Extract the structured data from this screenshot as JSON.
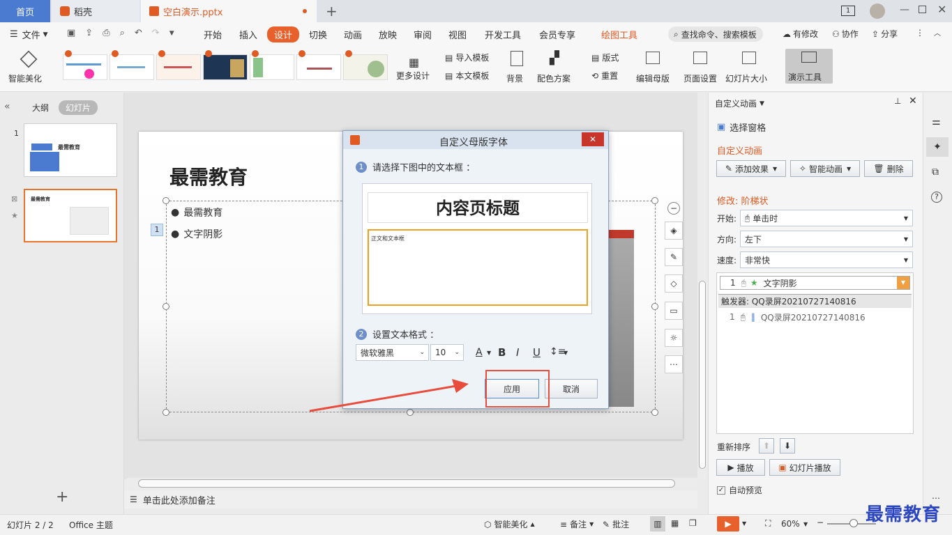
{
  "tabs": {
    "home": "首页",
    "daoke": "稻壳",
    "doc": "空白演示.pptx"
  },
  "menu": {
    "file": "文件",
    "items": [
      "开始",
      "插入",
      "设计",
      "切换",
      "动画",
      "放映",
      "审阅",
      "视图",
      "开发工具",
      "会员专享"
    ],
    "drawing_tools": "绘图工具",
    "search": "查找命令、搜索模板",
    "modify": "有修改",
    "collab": "协作",
    "share": "分享"
  },
  "ribbon": {
    "smart_beautify": "智能美化",
    "more_design": "更多设计",
    "import_template": "导入模板",
    "this_template": "本文模板",
    "background": "背景",
    "color_scheme": "配色方案",
    "layout": "版式",
    "reset": "重置",
    "edit_master": "编辑母版",
    "page_setup": "页面设置",
    "slide_size": "幻灯片大小",
    "present_tools": "演示工具",
    "theme_thumbs": [
      "",
      "",
      "",
      "",
      "",
      "",
      "",
      ""
    ]
  },
  "left": {
    "outline": "大纲",
    "slides": "幻灯片",
    "slide1_num": "1",
    "slide1_title": "最需教育",
    "slide2_num": "2",
    "slide2_title": "最需教育"
  },
  "slide": {
    "title": "最需教育",
    "bullet1": "最需教育",
    "bullet2": "文字阴影",
    "anim_tag": "1"
  },
  "notes": "单击此处添加备注",
  "dialog": {
    "title": "自定义母版字体",
    "step1": "请选择下图中的文本框 ：",
    "step1_num": "1",
    "preview_title": "内容页标题",
    "preview_body": "正文和文本框",
    "step2": "设置文本格式 ：",
    "step2_num": "2",
    "font": "微软雅黑",
    "size": "10",
    "apply": "应用",
    "cancel": "取消"
  },
  "anim": {
    "header": "自定义动画",
    "select_pane": "选择窗格",
    "section": "自定义动画",
    "add_effect": "添加效果",
    "smart_anim": "智能动画",
    "delete": "删除",
    "modify": "修改: 阶梯状",
    "start_label": "开始:",
    "start_val": "单击时",
    "dir_label": "方向:",
    "dir_val": "左下",
    "speed_label": "速度:",
    "speed_val": "非常快",
    "item1_num": "1",
    "item1": "文字阴影",
    "trigger": "触发器: QQ录屏20210727140816",
    "item2_num": "1",
    "item2": "QQ录屏20210727140816",
    "reorder": "重新排序",
    "play": "播放",
    "slideshow": "幻灯片播放",
    "autopreview": "自动预览"
  },
  "status": {
    "slide": "幻灯片 2 / 2",
    "theme": "Office 主题",
    "smart": "智能美化",
    "notes": "备注",
    "comments": "批注",
    "zoom": "60%"
  },
  "watermark": "最需教育",
  "colors": {
    "accent": "#e05a24",
    "design_tab": "#e8612c",
    "blue": "#4a7bd0",
    "highlight": "#e74c3c"
  }
}
